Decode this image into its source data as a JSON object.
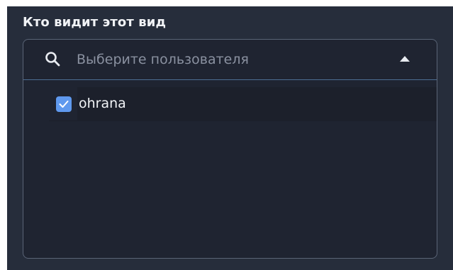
{
  "section": {
    "title": "Кто видит этот вид"
  },
  "user_select": {
    "placeholder": "Выберите пользователя",
    "search_icon": "search-icon",
    "toggle_icon": "caret-up-icon",
    "expanded": true,
    "options": [
      {
        "label": "ohrana",
        "checked": true
      }
    ]
  },
  "colors": {
    "panel_bg": "#262d3b",
    "dropdown_bg": "#1f2431",
    "checkbox_accent": "#5f99ee",
    "divider": "#4d6f93",
    "text": "#f1f3f6",
    "placeholder": "#8a91a0"
  }
}
